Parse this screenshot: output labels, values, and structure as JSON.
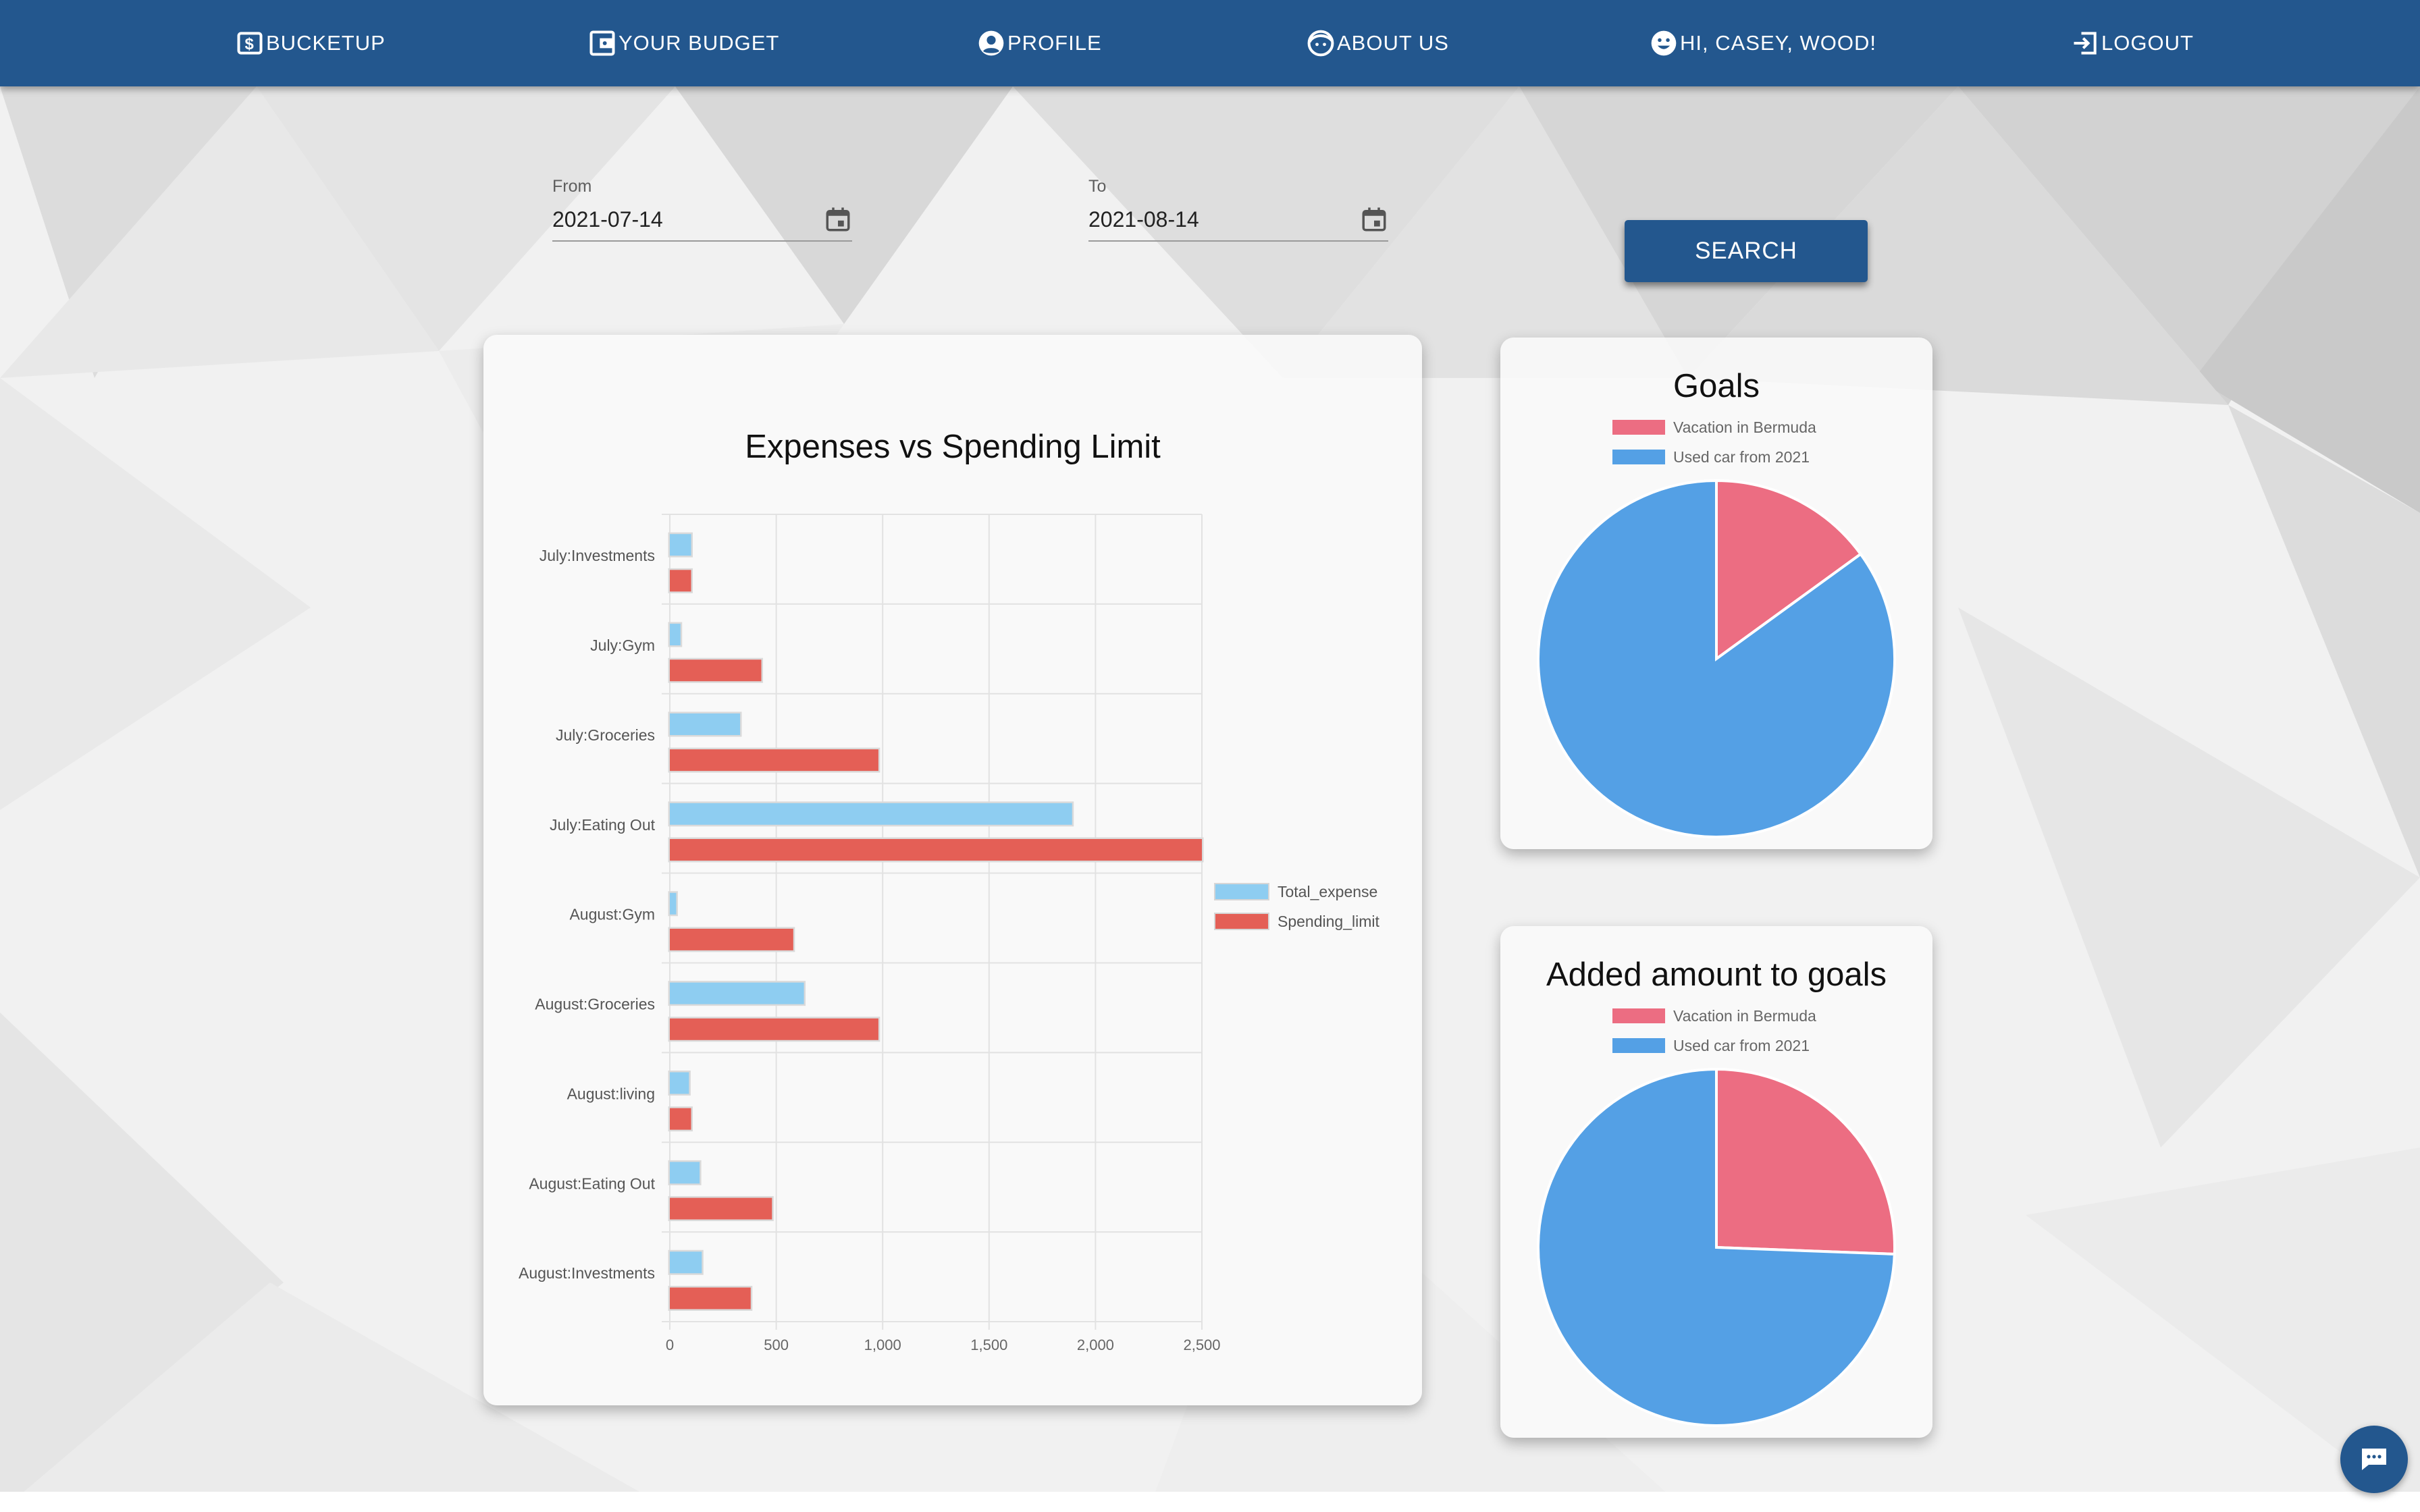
{
  "nav": {
    "brand": "BUCKETUP",
    "budget": "YOUR BUDGET",
    "profile": "PROFILE",
    "about": "ABOUT US",
    "greeting": "HI, CASEY, WOOD!",
    "logout": "LOGOUT"
  },
  "filters": {
    "from_label": "From",
    "from_value": "2021-07-14",
    "to_label": "To",
    "to_value": "2021-08-14",
    "search_label": "SEARCH"
  },
  "colors": {
    "nav": "#23578e",
    "expense": "#8ecdf1",
    "limit": "#e45f56",
    "pie_red": "#ec6d82",
    "pie_blue": "#54a0e5"
  },
  "chart_data": [
    {
      "type": "bar",
      "orientation": "horizontal",
      "title": "Expenses vs Spending Limit",
      "categories": [
        "July:Investments",
        "July:Gym",
        "July:Groceries",
        "July:Eating Out",
        "August:Gym",
        "August:Groceries",
        "August:living",
        "August:Eating Out",
        "August:Investments"
      ],
      "series": [
        {
          "name": "Total_expense",
          "values": [
            100,
            50,
            330,
            1890,
            30,
            630,
            90,
            140,
            150
          ]
        },
        {
          "name": "Spending_limit",
          "values": [
            100,
            430,
            980,
            2500,
            580,
            980,
            100,
            480,
            380
          ]
        }
      ],
      "xlim": [
        0,
        2500
      ],
      "xticks": [
        "0",
        "500",
        "1,000",
        "1,500",
        "2,000",
        "2,500"
      ],
      "legend": "right",
      "grid": true
    },
    {
      "type": "pie",
      "title": "Goals",
      "labels": [
        "Vacation in Bermuda",
        "Used car from 2021"
      ],
      "values": [
        15,
        85
      ],
      "legend": "top"
    },
    {
      "type": "pie",
      "title": "Added amount to goals",
      "labels": [
        "Vacation in Bermuda",
        "Used car from 2021"
      ],
      "values": [
        25.6,
        74.4
      ],
      "legend": "top"
    }
  ]
}
